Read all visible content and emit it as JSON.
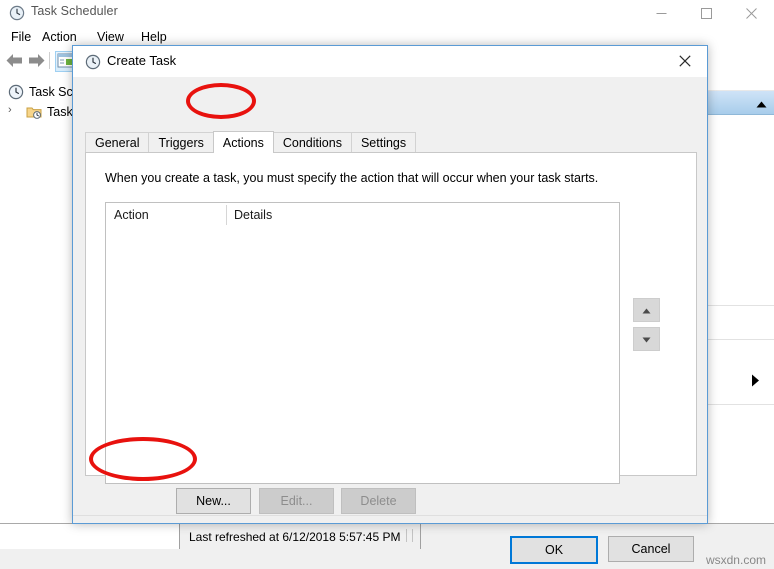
{
  "app": {
    "title": "Task Scheduler",
    "icon": "clock-icon",
    "window_buttons": {
      "minimize": "minimize-icon",
      "maximize": "maximize-icon",
      "close": "close-icon"
    },
    "menu": [
      "File",
      "Action",
      "View",
      "Help"
    ],
    "toolbar": {
      "back": "back-arrow-icon",
      "forward": "forward-arrow-icon",
      "properties": "properties-icon"
    },
    "tree": {
      "root_label": "Task Sche",
      "root_icon": "clock-icon",
      "child_label": "Task S",
      "child_icon": "folder-clock-icon",
      "expander": "›"
    },
    "side_pane": {
      "collapse_icon": "chevron-up-icon",
      "expand_icon": "triangle-right-icon"
    },
    "statusbar": {
      "text": "Last refreshed at 6/12/2018 5:57:45 PM"
    },
    "watermark": "wsxdn.com"
  },
  "dialog": {
    "title": "Create Task",
    "icon": "clock-icon",
    "close_icon": "close-icon",
    "tabs": [
      {
        "label": "General",
        "selected": false
      },
      {
        "label": "Triggers",
        "selected": false
      },
      {
        "label": "Actions",
        "selected": true
      },
      {
        "label": "Conditions",
        "selected": false
      },
      {
        "label": "Settings",
        "selected": false
      }
    ],
    "intro_text": "When you create a task, you must specify the action that will occur when your task starts.",
    "grid": {
      "columns": [
        "Action",
        "Details"
      ],
      "rows": []
    },
    "move_buttons": {
      "up": "triangle-up-icon",
      "down": "triangle-down-icon"
    },
    "buttons": {
      "new": "New...",
      "edit": "Edit...",
      "delete": "Delete",
      "ok": "OK",
      "cancel": "Cancel"
    },
    "states": {
      "new_enabled": true,
      "edit_enabled": false,
      "delete_enabled": false,
      "ok_is_default": true
    }
  },
  "annotations": {
    "color": "#e8120e",
    "highlighted": [
      "Actions tab",
      "New... button"
    ]
  }
}
